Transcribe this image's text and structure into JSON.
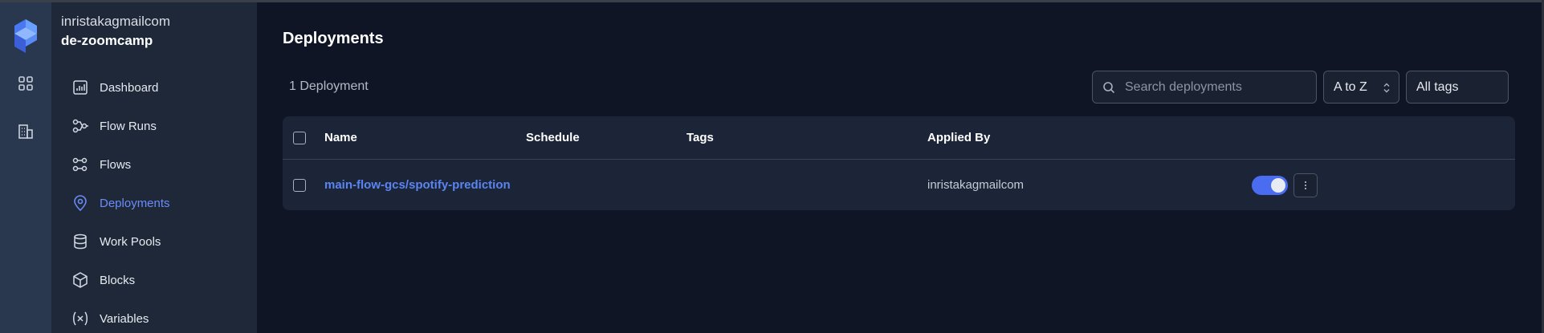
{
  "account": {
    "user": "inristakagmailcom",
    "workspace": "de-zoomcamp"
  },
  "sidebar": {
    "items": [
      {
        "label": "Dashboard",
        "icon": "dashboard-icon"
      },
      {
        "label": "Flow Runs",
        "icon": "flow-runs-icon"
      },
      {
        "label": "Flows",
        "icon": "flows-icon"
      },
      {
        "label": "Deployments",
        "icon": "map-pin-icon",
        "active": true
      },
      {
        "label": "Work Pools",
        "icon": "database-icon"
      },
      {
        "label": "Blocks",
        "icon": "cube-icon"
      },
      {
        "label": "Variables",
        "icon": "variable-icon"
      }
    ]
  },
  "page": {
    "title": "Deployments",
    "count": "1 Deployment"
  },
  "filters": {
    "search_placeholder": "Search deployments",
    "sort_value": "A to Z",
    "tags_value": "All tags"
  },
  "table": {
    "columns": [
      "Name",
      "Schedule",
      "Tags",
      "Applied By"
    ],
    "rows": [
      {
        "name": "main-flow-gcs/spotify-prediction",
        "schedule": "",
        "tags": "",
        "applied_by": "inristakagmailcom",
        "active": true
      }
    ]
  },
  "colors": {
    "accent": "#4a6cf0",
    "link": "#5a84f2",
    "background": "#0f1524",
    "sidebar": "#1e2839",
    "rail": "#29384e"
  }
}
